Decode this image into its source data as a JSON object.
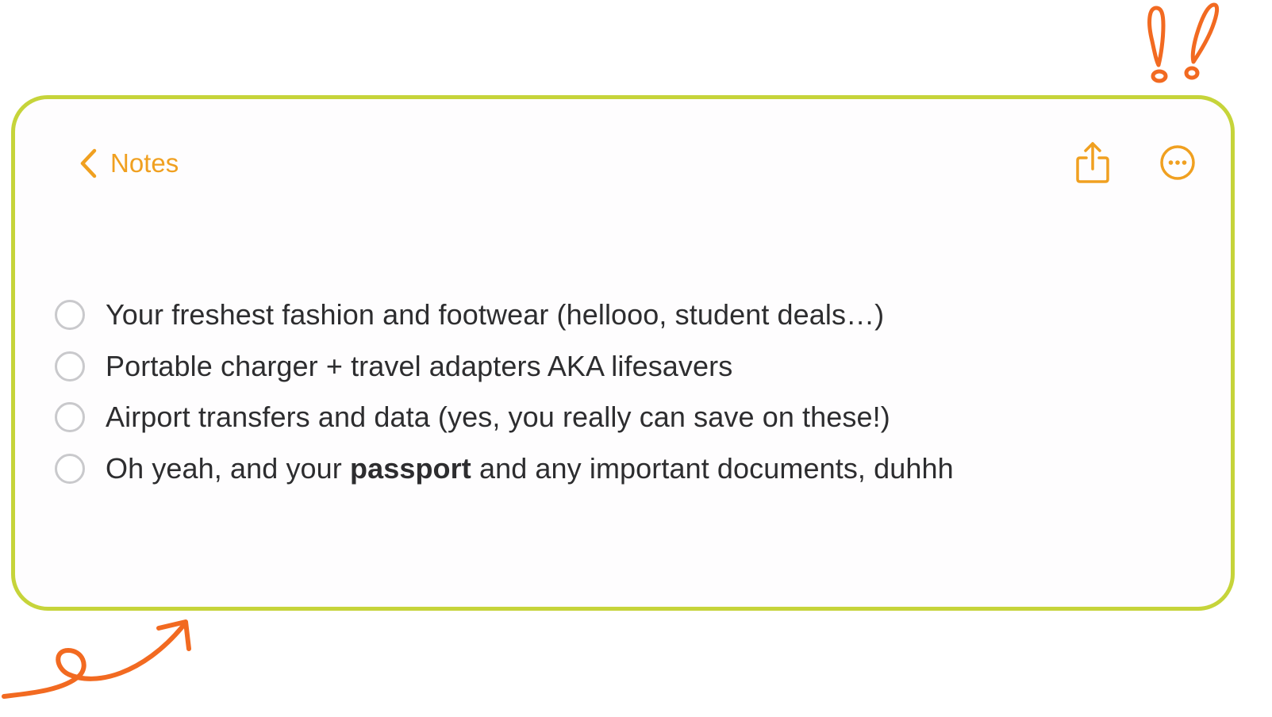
{
  "nav": {
    "back_label": "Notes",
    "back_icon": "chevron-left-icon",
    "share_icon": "share-icon",
    "more_icon": "ellipsis-circle-icon"
  },
  "checklist": {
    "items": [
      {
        "checked": false,
        "text": "Your freshest fashion and footwear (hellooo, student deals…)"
      },
      {
        "checked": false,
        "text": "Portable charger + travel adapters AKA lifesavers"
      },
      {
        "checked": false,
        "text": "Airport transfers and data (yes, you really can save on these!)"
      },
      {
        "checked": false,
        "text_before": "Oh yeah, and your ",
        "text_bold": "passport",
        "text_after": " and any important documents, duhhh"
      }
    ]
  },
  "colors": {
    "accent": "#f0a020",
    "card_border": "#c6d43a",
    "doodle": "#f26a21",
    "checkbox_border": "#c9c9cc",
    "text": "#2d2d2f"
  }
}
